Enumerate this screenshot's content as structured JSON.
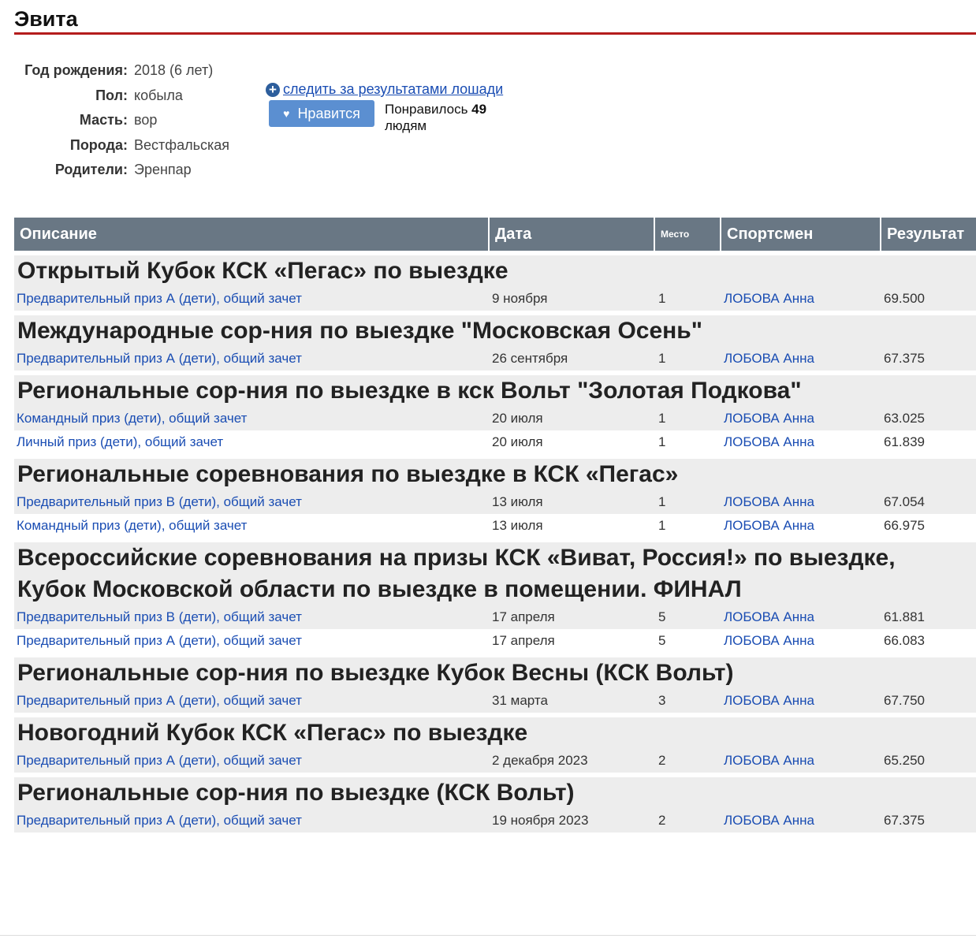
{
  "page": {
    "title": "Эвита"
  },
  "info": [
    {
      "label": "Год рождения:",
      "value": "2018 (6 лет)"
    },
    {
      "label": "Пол:",
      "value": "кобыла"
    },
    {
      "label": "Масть:",
      "value": "вор"
    },
    {
      "label": "Порода:",
      "value": "Вестфальская"
    },
    {
      "label": "Родители:",
      "value": "Эренпар"
    }
  ],
  "actions": {
    "follow_icon": "plus-circle-icon",
    "follow_label": " следить за результатами лошади",
    "like_label": "Нравится",
    "like_icon": "heart-icon",
    "likes_prefix": "Понравилось ",
    "likes_count": "49",
    "likes_suffix": "людям"
  },
  "table": {
    "headers": [
      "Описание",
      "Дата",
      "Место",
      "Спортсмен",
      "Результат"
    ],
    "groups": [
      {
        "event": "Открытый Кубок КСК «Пегас» по выездке",
        "rows": [
          {
            "desc": "Предварительный приз А (дети), общий зачет",
            "date": "9 ноября",
            "place": "1",
            "rider": "ЛОБОВА Анна",
            "result": "69.500"
          }
        ]
      },
      {
        "event": "Международные сор-ния по выездке \"Московская Осень\"",
        "rows": [
          {
            "desc": "Предварительный приз А (дети), общий зачет",
            "date": "26 сентября",
            "place": "1",
            "rider": "ЛОБОВА Анна",
            "result": "67.375"
          }
        ]
      },
      {
        "event": "Региональные сор-ния по выездке в кск Вольт \"Золотая Подкова\"",
        "rows": [
          {
            "desc": "Командный приз (дети), общий зачет",
            "date": "20 июля",
            "place": "1",
            "rider": "ЛОБОВА Анна",
            "result": "63.025"
          },
          {
            "desc": "Личный приз (дети), общий зачет",
            "date": "20 июля",
            "place": "1",
            "rider": "ЛОБОВА Анна",
            "result": "61.839"
          }
        ]
      },
      {
        "event": "Региональные соревнования по выездке в КСК «Пегас»",
        "rows": [
          {
            "desc": "Предварительный приз В (дети), общий зачет",
            "date": "13 июля",
            "place": "1",
            "rider": "ЛОБОВА Анна",
            "result": "67.054"
          },
          {
            "desc": "Командный приз (дети), общий зачет",
            "date": "13 июля",
            "place": "1",
            "rider": "ЛОБОВА Анна",
            "result": "66.975"
          }
        ]
      },
      {
        "event": "Всероссийские соревнования на призы КСК «Виват, Россия!» по выездке,",
        "event2": "Кубок Московской области по выездке в помещении. ФИНАЛ",
        "rows": [
          {
            "desc": "Предварительный приз В (дети), общий зачет",
            "date": "17 апреля",
            "place": "5",
            "rider": "ЛОБОВА Анна",
            "result": "61.881"
          },
          {
            "desc": "Предварительный приз А (дети), общий зачет",
            "date": "17 апреля",
            "place": "5",
            "rider": "ЛОБОВА Анна",
            "result": "66.083"
          }
        ]
      },
      {
        "event": "Региональные сор-ния по выездке Кубок Весны (КСК Вольт)",
        "rows": [
          {
            "desc": "Предварительный приз А (дети), общий зачет",
            "date": "31 марта",
            "place": "3",
            "rider": "ЛОБОВА Анна",
            "result": "67.750"
          }
        ]
      },
      {
        "event": "Новогодний Кубок КСК «Пегас» по выездке",
        "rows": [
          {
            "desc": "Предварительный приз А (дети), общий зачет",
            "date": "2 декабря 2023",
            "place": "2",
            "rider": "ЛОБОВА Анна",
            "result": "65.250"
          }
        ]
      },
      {
        "event": "Региональные сор-ния по выездке (КСК Вольт)",
        "rows": [
          {
            "desc": "Предварительный приз А (дети), общий зачет",
            "date": "19 ноября 2023",
            "place": "2",
            "rider": "ЛОБОВА Анна",
            "result": "67.375"
          }
        ]
      }
    ]
  }
}
